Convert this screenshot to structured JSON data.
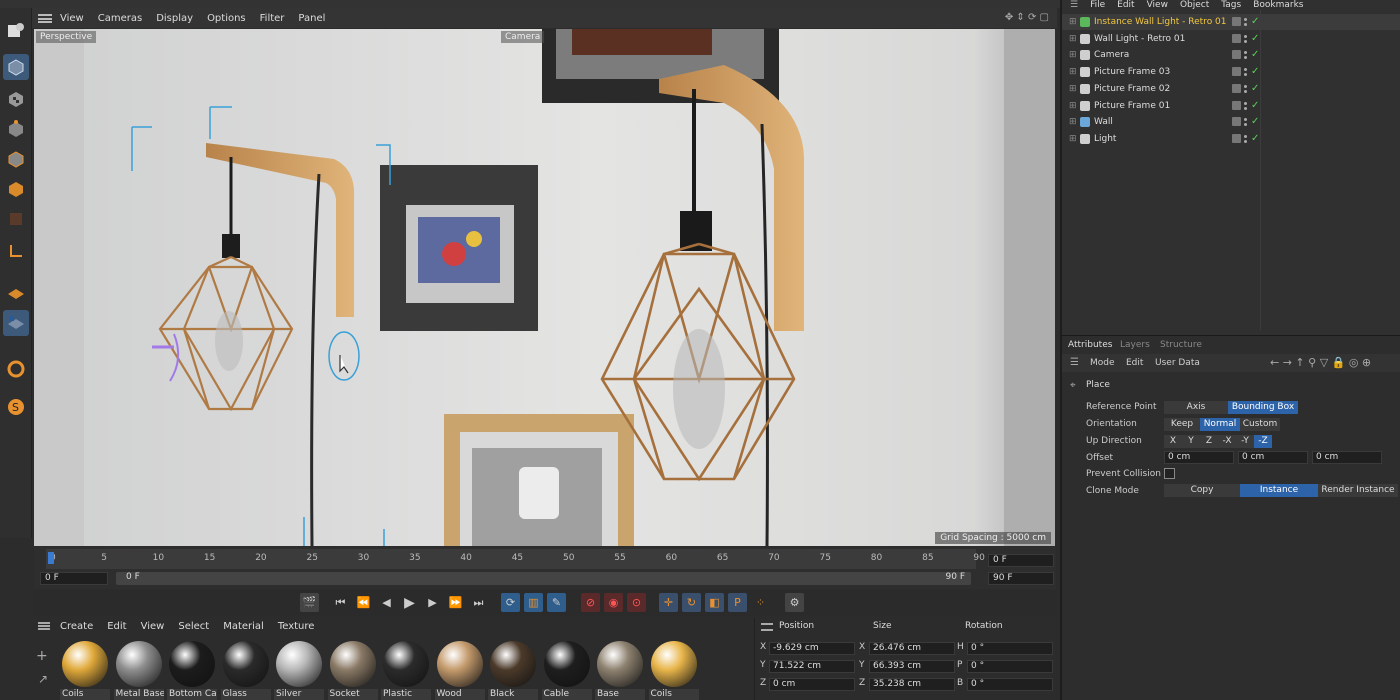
{
  "viewport_menu": {
    "items": [
      "View",
      "Cameras",
      "Display",
      "Options",
      "Filter",
      "Panel"
    ]
  },
  "viewport": {
    "label_left": "Perspective",
    "label_camera": "Camera",
    "grid_spacing": "Grid Spacing : 5000 cm"
  },
  "timeline": {
    "ticks": [
      "0",
      "5",
      "10",
      "15",
      "20",
      "25",
      "30",
      "35",
      "40",
      "45",
      "50",
      "55",
      "60",
      "65",
      "70",
      "75",
      "80",
      "85",
      "90"
    ],
    "current_frame": "0 F",
    "start_frame": "0 F",
    "range_start": "0 F",
    "range_end": "90 F",
    "end_frame": "90 F"
  },
  "material_menu": {
    "items": [
      "Create",
      "Edit",
      "View",
      "Select",
      "Material",
      "Texture"
    ]
  },
  "materials": [
    {
      "name": "Coils",
      "color": "#e0a93a"
    },
    {
      "name": "Metal Base",
      "color": "#8e8e8e"
    },
    {
      "name": "Bottom Ca",
      "color": "#1c1c1c"
    },
    {
      "name": "Glass",
      "color": "#2a2a2a"
    },
    {
      "name": "Silver",
      "color": "#b7b7b7"
    },
    {
      "name": "Socket",
      "color": "#8a7a66"
    },
    {
      "name": "Plastic",
      "color": "#2b2b2b"
    },
    {
      "name": "Wood",
      "color": "#c49a6c"
    },
    {
      "name": "Black",
      "color": "#4b3a2a"
    },
    {
      "name": "Cable",
      "color": "#1e1e1e"
    },
    {
      "name": "Base",
      "color": "#8e8270"
    },
    {
      "name": "Coils",
      "color": "#e8b54a"
    }
  ],
  "coordinates": {
    "headers": {
      "position": "Position",
      "size": "Size",
      "rotation": "Rotation"
    },
    "rows": [
      {
        "pos_axis": "X",
        "pos": "-9.629 cm",
        "size_axis": "X",
        "size": "26.476 cm",
        "rot_axis": "H",
        "rot": "0 °"
      },
      {
        "pos_axis": "Y",
        "pos": "71.522 cm",
        "size_axis": "Y",
        "size": "66.393 cm",
        "rot_axis": "P",
        "rot": "0 °"
      },
      {
        "pos_axis": "Z",
        "pos": "0 cm",
        "size_axis": "Z",
        "size": "35.238 cm",
        "rot_axis": "B",
        "rot": "0 °"
      }
    ]
  },
  "object_menu": {
    "items": [
      "File",
      "Edit",
      "View",
      "Object",
      "Tags",
      "Bookmarks"
    ]
  },
  "objects": [
    {
      "name": "Instance Wall Light - Retro 01",
      "selected": true,
      "icon_color": "#5bb85b"
    },
    {
      "name": "Wall Light - Retro 01",
      "selected": false,
      "icon_color": "#cfcfcf"
    },
    {
      "name": "Camera",
      "selected": false,
      "icon_color": "#cfcfcf"
    },
    {
      "name": "Picture Frame 03",
      "selected": false,
      "icon_color": "#cfcfcf"
    },
    {
      "name": "Picture Frame 02",
      "selected": false,
      "icon_color": "#cfcfcf"
    },
    {
      "name": "Picture Frame 01",
      "selected": false,
      "icon_color": "#cfcfcf"
    },
    {
      "name": "Wall",
      "selected": false,
      "icon_color": "#6aa6d8"
    },
    {
      "name": "Light",
      "selected": false,
      "icon_color": "#cfcfcf"
    }
  ],
  "attributes": {
    "tabs": [
      "Attributes",
      "Layers",
      "Structure"
    ],
    "menu": [
      "Mode",
      "Edit",
      "User Data"
    ],
    "section": "Place",
    "reference_point": {
      "label": "Reference Point",
      "options": [
        "Axis",
        "Bounding Box"
      ],
      "selected": "Bounding Box"
    },
    "orientation": {
      "label": "Orientation",
      "options": [
        "Keep",
        "Normal",
        "Custom"
      ],
      "selected": "Normal"
    },
    "up_direction": {
      "label": "Up Direction",
      "options": [
        "X",
        "Y",
        "Z",
        "-X",
        "-Y",
        "-Z"
      ],
      "selected": "-Z"
    },
    "offset": {
      "label": "Offset",
      "values": [
        "0 cm",
        "0 cm",
        "0 cm"
      ]
    },
    "prevent_collision": {
      "label": "Prevent Collision",
      "checked": false
    },
    "clone_mode": {
      "label": "Clone Mode",
      "options": [
        "Copy",
        "Instance",
        "Render Instance"
      ],
      "selected": "Instance"
    }
  }
}
